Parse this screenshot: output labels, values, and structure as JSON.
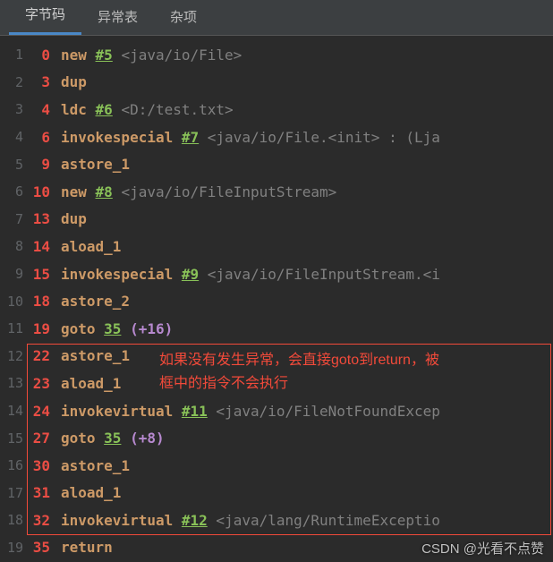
{
  "tabs": {
    "bytecode": "字节码",
    "exception_table": "异常表",
    "misc": "杂项"
  },
  "annotation": {
    "line1": "如果没有发生异常，会直接goto到return，被",
    "line2": "框中的指令不会执行"
  },
  "watermark": "CSDN @光看不点赞",
  "code": [
    {
      "n": "1",
      "off": "0",
      "op": "new",
      "ref": "#5",
      "tail": "<java/io/File>"
    },
    {
      "n": "2",
      "off": "3",
      "op": "dup"
    },
    {
      "n": "3",
      "off": "4",
      "op": "ldc",
      "ref": "#6",
      "tail": "<D:/test.txt>"
    },
    {
      "n": "4",
      "off": "6",
      "op": "invokespecial",
      "ref": "#7",
      "tail": "<java/io/File.<init> : (Lja"
    },
    {
      "n": "5",
      "off": "9",
      "op": "astore_1"
    },
    {
      "n": "6",
      "off": "10",
      "op": "new",
      "ref": "#8",
      "tail": "<java/io/FileInputStream>"
    },
    {
      "n": "7",
      "off": "13",
      "op": "dup"
    },
    {
      "n": "8",
      "off": "14",
      "op": "aload_1"
    },
    {
      "n": "9",
      "off": "15",
      "op": "invokespecial",
      "ref": "#9",
      "tail": "<java/io/FileInputStream.<i"
    },
    {
      "n": "10",
      "off": "18",
      "op": "astore_2"
    },
    {
      "n": "11",
      "off": "19",
      "op": "goto",
      "ref": "35",
      "plus": "(+16)"
    },
    {
      "n": "12",
      "off": "22",
      "op": "astore_1"
    },
    {
      "n": "13",
      "off": "23",
      "op": "aload_1"
    },
    {
      "n": "14",
      "off": "24",
      "op": "invokevirtual",
      "ref": "#11",
      "tail": "<java/io/FileNotFoundExcep"
    },
    {
      "n": "15",
      "off": "27",
      "op": "goto",
      "ref": "35",
      "plus": "(+8)"
    },
    {
      "n": "16",
      "off": "30",
      "op": "astore_1"
    },
    {
      "n": "17",
      "off": "31",
      "op": "aload_1"
    },
    {
      "n": "18",
      "off": "32",
      "op": "invokevirtual",
      "ref": "#12",
      "tail": "<java/lang/RuntimeExceptio"
    },
    {
      "n": "19",
      "off": "35",
      "op": "return"
    }
  ]
}
